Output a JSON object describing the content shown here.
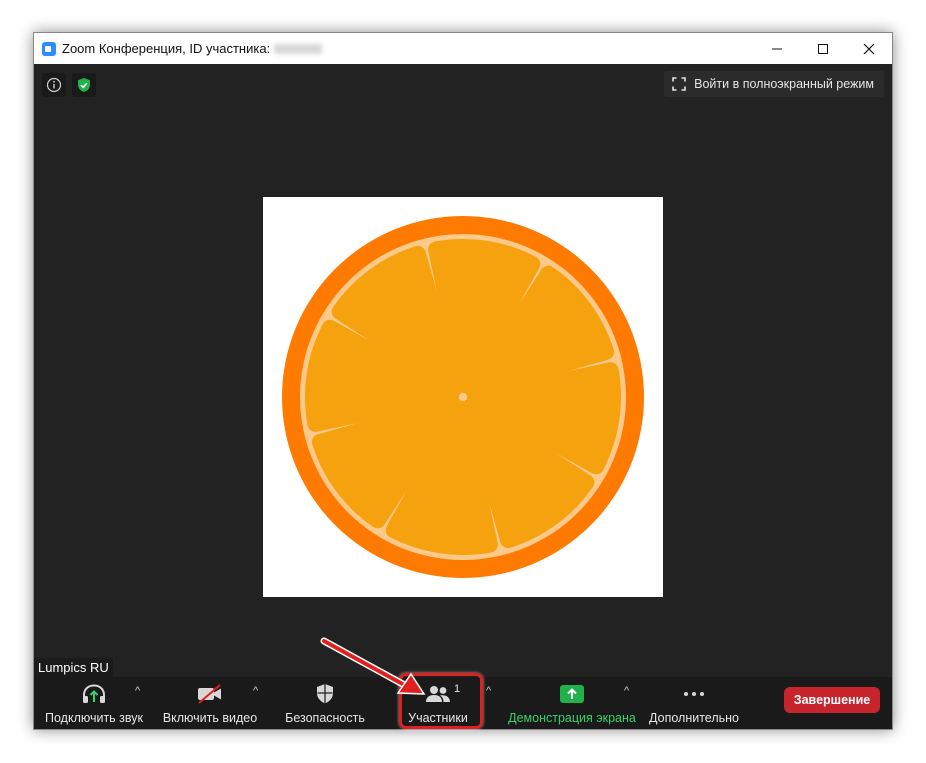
{
  "window": {
    "title": "Zoom Конференция, ID участника:",
    "controls": {
      "minimize": "—",
      "maximize": "☐",
      "close": "✕"
    }
  },
  "top_bar": {
    "info_icon": "info-icon",
    "security_icon": "shield-check-icon",
    "fullscreen_label": "Войти в полноэкранный режим"
  },
  "participant_name": "Lumpics RU",
  "toolbar": {
    "audio_label": "Подключить звук",
    "video_label": "Включить видео",
    "security_label": "Безопасность",
    "participants_label": "Участники",
    "participants_count": "1",
    "share_label": "Демонстрация экрана",
    "more_label": "Дополнительно",
    "end_label": "Завершение",
    "caret": "^"
  },
  "colors": {
    "accent_green": "#37d16b",
    "end_red": "#c8242c",
    "highlight_red": "#e0201e",
    "orange_rim": "#ff7a00",
    "orange_pith": "#ffc98a",
    "orange_segment": "#f5a20e"
  }
}
